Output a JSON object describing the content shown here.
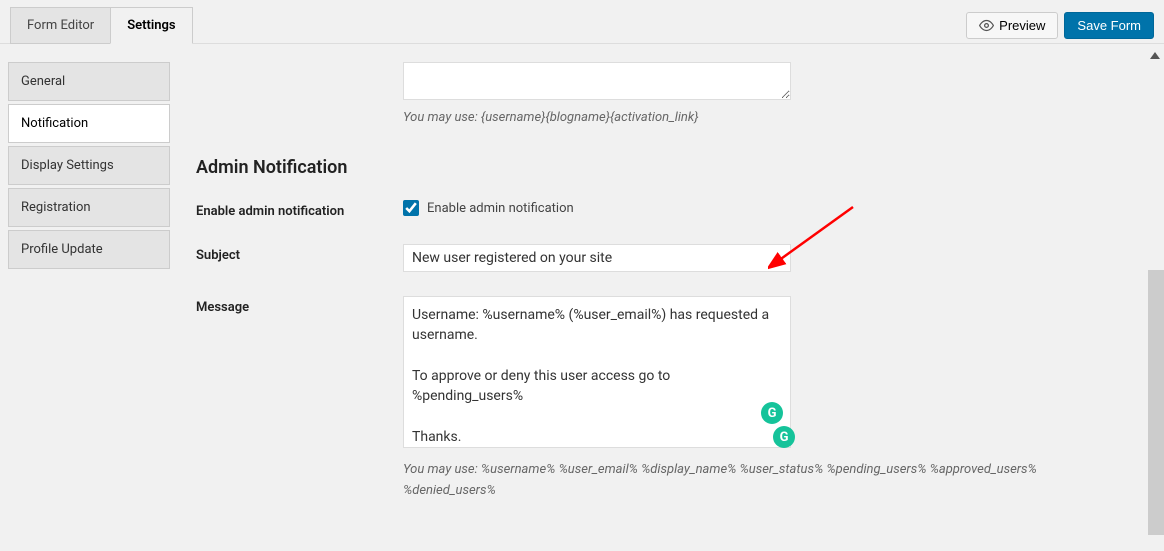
{
  "tabs": {
    "form_editor": "Form Editor",
    "settings": "Settings"
  },
  "actions": {
    "preview": "Preview",
    "save_form": "Save Form"
  },
  "sidebar": {
    "items": [
      {
        "label": "General"
      },
      {
        "label": "Notification"
      },
      {
        "label": "Display Settings"
      },
      {
        "label": "Registration"
      },
      {
        "label": "Profile Update"
      }
    ]
  },
  "top_hint": "You may use: {username}{blogname}{activation_link}",
  "section": {
    "heading": "Admin Notification",
    "enable_label": "Enable admin notification",
    "enable_checkbox_label": "Enable admin notification",
    "subject_label": "Subject",
    "subject_value": "New user registered on your site",
    "message_label": "Message",
    "message_value": "Username: %username% (%user_email%) has requested a username.\n\nTo approve or deny this user access go to %pending_users%\n\nThanks.",
    "message_hint": "You may use: %username% %user_email% %display_name% %user_status% %pending_users% %approved_users% %denied_users%"
  },
  "badges": {
    "g": "G"
  }
}
